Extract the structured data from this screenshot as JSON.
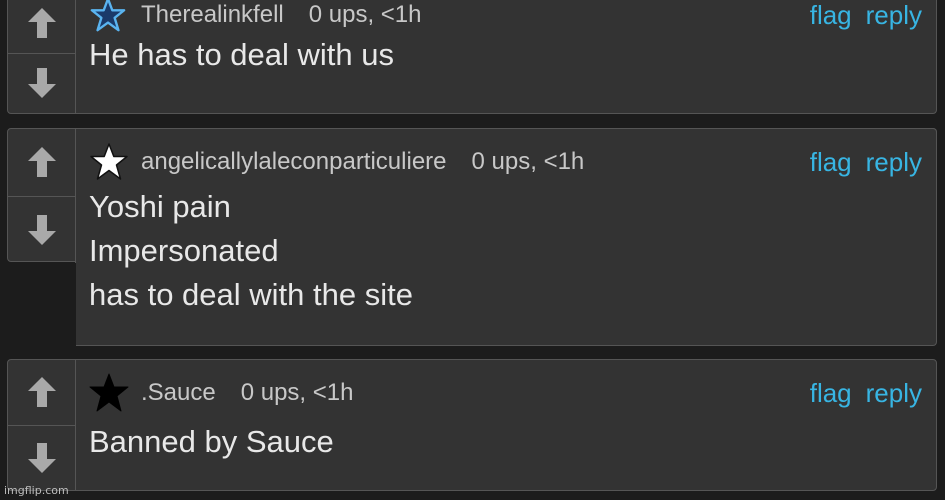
{
  "comments": [
    {
      "username": "Therealinkfell",
      "badge": "outline-blue-star-icon",
      "stats": "0 ups, <1h",
      "flag": "flag",
      "reply": "reply",
      "lines": [
        "He has to deal with us"
      ]
    },
    {
      "username": "angelicallylaleconparticuliere",
      "badge": "white-star-icon",
      "stats": "0 ups, <1h",
      "flag": "flag",
      "reply": "reply",
      "lines": [
        "Yoshi pain",
        "Impersonated",
        "has to deal with the site"
      ]
    },
    {
      "username": ".Sauce",
      "badge": "black-star-icon",
      "stats": "0 ups, <1h",
      "flag": "flag",
      "reply": "reply",
      "lines": [
        "Banned by Sauce"
      ]
    }
  ],
  "watermark": "imgflip.com",
  "colors": {
    "background": "#1c1c1c",
    "panel": "#333333",
    "border": "#555555",
    "link": "#38b5e3",
    "text": "#e8e8e8",
    "meta": "#c8c8c8",
    "arrow": "#a9a9a9"
  }
}
